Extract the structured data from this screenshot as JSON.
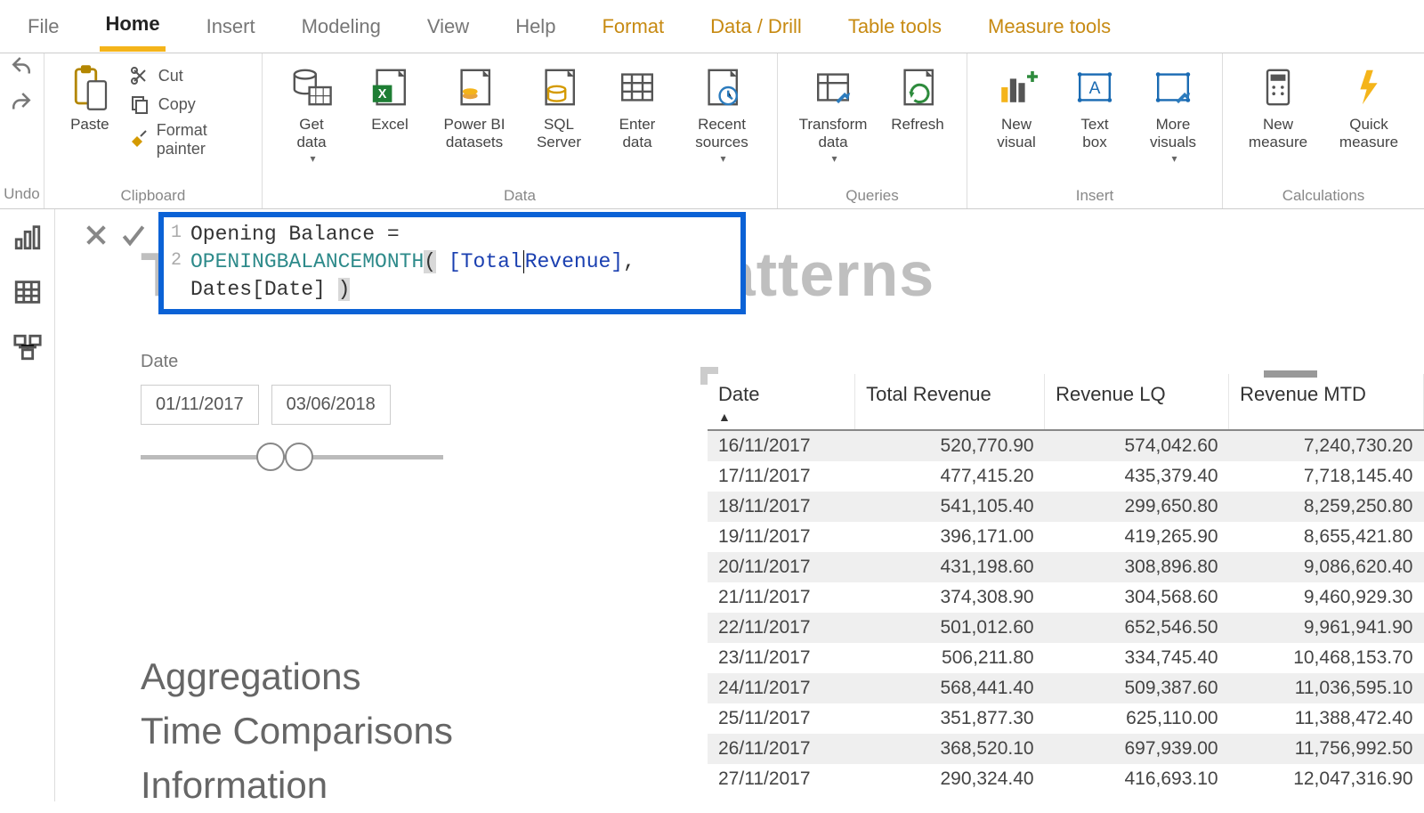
{
  "ribbon_tabs": {
    "file": "File",
    "home": "Home",
    "insert": "Insert",
    "modeling": "Modeling",
    "view": "View",
    "help": "Help",
    "format": "Format",
    "data_drill": "Data / Drill",
    "table_tools": "Table tools",
    "measure_tools": "Measure tools"
  },
  "ribbon": {
    "undo": {
      "undo": "Undo",
      "label": "Undo"
    },
    "clipboard": {
      "paste": "Paste",
      "cut": "Cut",
      "copy": "Copy",
      "format_painter": "Format painter",
      "group": "Clipboard"
    },
    "data": {
      "get_data": "Get\ndata",
      "excel": "Excel",
      "pbi_ds": "Power BI\ndatasets",
      "sql": "SQL\nServer",
      "enter": "Enter\ndata",
      "recent": "Recent\nsources",
      "group": "Data"
    },
    "queries": {
      "transform": "Transform\ndata",
      "refresh": "Refresh",
      "group": "Queries"
    },
    "insert": {
      "new_visual": "New\nvisual",
      "text_box": "Text\nbox",
      "more_visuals": "More\nvisuals",
      "group": "Insert"
    },
    "calc": {
      "new_measure": "New\nmeasure",
      "quick_measure": "Quick\nmeasure",
      "group": "Calculations"
    }
  },
  "formula": {
    "line1": "Opening Balance =",
    "func": "OPENINGBALANCEMONTH",
    "open_paren": "(",
    "arg1a": " [Total",
    "arg1b": "Revenue]",
    "sep": ", ",
    "arg2": "Dates[Date] ",
    "close_paren": ")"
  },
  "page_title": "Time Intelligence Patterns",
  "slicer": {
    "label": "Date",
    "from": "01/11/2017",
    "to": "03/06/2018"
  },
  "nav_items": [
    "Aggregations",
    "Time Comparisons",
    "Information"
  ],
  "table": {
    "headers": [
      "Date",
      "Total Revenue",
      "Revenue LQ",
      "Revenue MTD"
    ],
    "sort_col": 0,
    "rows": [
      [
        "16/11/2017",
        "520,770.90",
        "574,042.60",
        "7,240,730.20"
      ],
      [
        "17/11/2017",
        "477,415.20",
        "435,379.40",
        "7,718,145.40"
      ],
      [
        "18/11/2017",
        "541,105.40",
        "299,650.80",
        "8,259,250.80"
      ],
      [
        "19/11/2017",
        "396,171.00",
        "419,265.90",
        "8,655,421.80"
      ],
      [
        "20/11/2017",
        "431,198.60",
        "308,896.80",
        "9,086,620.40"
      ],
      [
        "21/11/2017",
        "374,308.90",
        "304,568.60",
        "9,460,929.30"
      ],
      [
        "22/11/2017",
        "501,012.60",
        "652,546.50",
        "9,961,941.90"
      ],
      [
        "23/11/2017",
        "506,211.80",
        "334,745.40",
        "10,468,153.70"
      ],
      [
        "24/11/2017",
        "568,441.40",
        "509,387.60",
        "11,036,595.10"
      ],
      [
        "25/11/2017",
        "351,877.30",
        "625,110.00",
        "11,388,472.40"
      ],
      [
        "26/11/2017",
        "368,520.10",
        "697,939.00",
        "11,756,992.50"
      ],
      [
        "27/11/2017",
        "290,324.40",
        "416,693.10",
        "12,047,316.90"
      ]
    ]
  }
}
